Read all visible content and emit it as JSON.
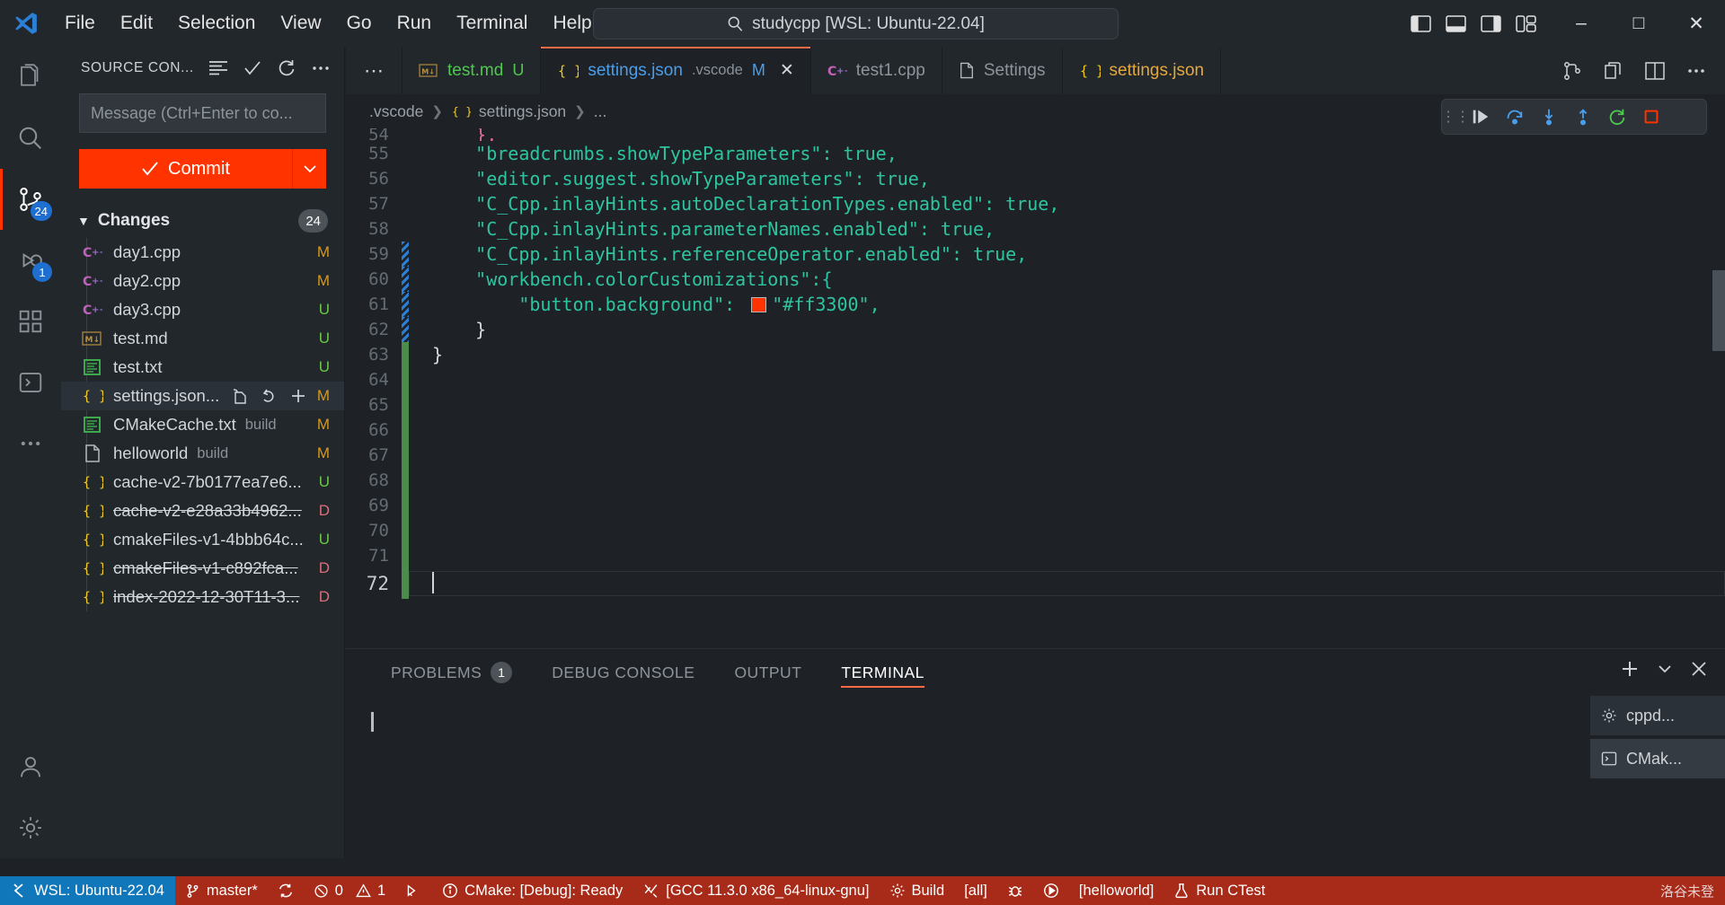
{
  "titlebar": {
    "menus": [
      "File",
      "Edit",
      "Selection",
      "View",
      "Go",
      "Run",
      "Terminal",
      "Help"
    ],
    "back_icon": "arrow-left-icon",
    "forward_icon": "arrow-right-icon",
    "command_center_text": "studycpp [WSL: Ubuntu-22.04]",
    "search_icon": "search-icon",
    "window_controls": [
      "minimize",
      "maximize",
      "close"
    ],
    "layout_icons": [
      "panel-left-icon",
      "panel-bottom-icon",
      "panel-right-icon",
      "layout-grid-icon"
    ]
  },
  "activitybar": {
    "items": [
      {
        "name": "explorer",
        "icon": "files-icon",
        "badge": "",
        "active": false
      },
      {
        "name": "search",
        "icon": "search-icon",
        "badge": "",
        "active": false
      },
      {
        "name": "source-control",
        "icon": "source-control-icon",
        "badge": "24",
        "active": true
      },
      {
        "name": "run-and-debug",
        "icon": "debug-icon",
        "badge": "1",
        "active": false
      },
      {
        "name": "extensions",
        "icon": "extensions-icon",
        "badge": "",
        "active": false
      },
      {
        "name": "testing",
        "icon": "beaker-icon",
        "badge": "",
        "active": false
      },
      {
        "name": "more-views",
        "icon": "ellipsis-icon",
        "badge": "",
        "active": false
      }
    ],
    "bottom_items": [
      {
        "name": "accounts",
        "icon": "account-icon"
      },
      {
        "name": "manage-settings",
        "icon": "gear-icon"
      }
    ]
  },
  "sidebar": {
    "title": "SOURCE CON...",
    "header_actions": [
      "view-as-list-icon",
      "commit-check-icon",
      "refresh-icon",
      "more-actions-icon"
    ],
    "commit_input_placeholder": "Message (Ctrl+Enter to co...",
    "commit_button_label": "Commit",
    "commit_button_color": "#ff3300",
    "commit_dropdown_icon": "chevron-down-icon",
    "changes_label": "Changes",
    "changes_count": "24",
    "files": [
      {
        "name": "day1.cpp",
        "dir": "",
        "icon": "cpp-file-icon",
        "status": "M",
        "deleted": false,
        "selected": false
      },
      {
        "name": "day2.cpp",
        "dir": "",
        "icon": "cpp-file-icon",
        "status": "M",
        "deleted": false,
        "selected": false
      },
      {
        "name": "day3.cpp",
        "dir": "",
        "icon": "cpp-file-icon",
        "status": "U",
        "deleted": false,
        "selected": false
      },
      {
        "name": "test.md",
        "dir": "",
        "icon": "markdown-file-icon",
        "status": "U",
        "deleted": false,
        "selected": false
      },
      {
        "name": "test.txt",
        "dir": "",
        "icon": "text-file-icon",
        "status": "U",
        "deleted": false,
        "selected": false
      },
      {
        "name": "settings.json...",
        "dir": "",
        "icon": "json-file-icon",
        "status": "M",
        "deleted": false,
        "selected": true
      },
      {
        "name": "CMakeCache.txt",
        "dir": "build",
        "icon": "text-file-icon",
        "status": "M",
        "deleted": false,
        "selected": false
      },
      {
        "name": "helloworld",
        "dir": "build",
        "icon": "plain-file-icon",
        "status": "M",
        "deleted": false,
        "selected": false
      },
      {
        "name": "cache-v2-7b0177ea7e6...",
        "dir": "",
        "icon": "json-file-icon",
        "status": "U",
        "deleted": false,
        "selected": false
      },
      {
        "name": "cache-v2-e28a33b4962...",
        "dir": "",
        "icon": "json-file-icon",
        "status": "D",
        "deleted": true,
        "selected": false
      },
      {
        "name": "cmakeFiles-v1-4bbb64c...",
        "dir": "",
        "icon": "json-file-icon",
        "status": "U",
        "deleted": false,
        "selected": false
      },
      {
        "name": "cmakeFiles-v1-c892fca...",
        "dir": "",
        "icon": "json-file-icon",
        "status": "D",
        "deleted": true,
        "selected": false
      },
      {
        "name": "index-2022-12-30T11-3...",
        "dir": "",
        "icon": "json-file-icon",
        "status": "D",
        "deleted": true,
        "selected": false
      }
    ],
    "row_actions": [
      "open-file-icon",
      "discard-changes-icon",
      "stage-changes-icon"
    ]
  },
  "editor": {
    "tab_overflow_icon": "ellipsis-icon",
    "tabs": [
      {
        "label": "test.md",
        "icon": "markdown-file-icon",
        "suffix": "",
        "badge": "U",
        "active": false,
        "closable": false
      },
      {
        "label": "settings.json",
        "icon": "json-file-icon",
        "suffix": ".vscode",
        "badge": "M",
        "active": true,
        "closable": true
      },
      {
        "label": "test1.cpp",
        "icon": "cpp-file-icon",
        "suffix": "",
        "badge": "",
        "active": false,
        "closable": false
      },
      {
        "label": "Settings",
        "icon": "plain-file-icon",
        "suffix": "",
        "badge": "",
        "active": false,
        "closable": false
      },
      {
        "label": "settings.json",
        "icon": "json-file-icon",
        "suffix": "",
        "badge": "",
        "active": false,
        "closable": false
      }
    ],
    "tabbar_actions": [
      "split-and-compare-icon",
      "open-changes-icon",
      "split-editor-icon",
      "more-actions-icon"
    ],
    "breadcrumb": [
      ".vscode",
      "settings.json",
      "..."
    ],
    "breadcrumb_icon": "json-file-icon",
    "debug_toolbar": {
      "grip_icon": "drag-grip-icon",
      "buttons": [
        "continue-icon",
        "step-over-icon",
        "step-into-icon",
        "step-out-icon",
        "restart-icon",
        "stop-icon"
      ],
      "stop_color": "#ff3300"
    },
    "lines": [
      {
        "num": "54",
        "text": "    },",
        "mark": "",
        "current": false,
        "partial": true
      },
      {
        "num": "55",
        "text": "    \"breadcrumbs.showTypeParameters\": true,",
        "mark": "",
        "current": false
      },
      {
        "num": "56",
        "text": "    \"editor.suggest.showTypeParameters\": true,",
        "mark": "",
        "current": false
      },
      {
        "num": "57",
        "text": "    \"C_Cpp.inlayHints.autoDeclarationTypes.enabled\": true,",
        "mark": "",
        "current": false
      },
      {
        "num": "58",
        "text": "    \"C_Cpp.inlayHints.parameterNames.enabled\": true,",
        "mark": "",
        "current": false
      },
      {
        "num": "59",
        "text": "    \"C_Cpp.inlayHints.referenceOperator.enabled\": true,",
        "mark": "mod",
        "current": false
      },
      {
        "num": "60",
        "text": "    \"workbench.colorCustomizations\":{",
        "mark": "mod",
        "current": false
      },
      {
        "num": "61",
        "text": "        \"button.background\": ",
        "mark": "mod",
        "current": false,
        "swatch": "#ff3300",
        "after_swatch": "\"#ff3300\","
      },
      {
        "num": "62",
        "text": "    }",
        "mark": "mod",
        "current": false
      },
      {
        "num": "63",
        "text": "}",
        "mark": "add",
        "current": false
      },
      {
        "num": "64",
        "text": "",
        "mark": "add",
        "current": false
      },
      {
        "num": "65",
        "text": "",
        "mark": "add",
        "current": false
      },
      {
        "num": "66",
        "text": "",
        "mark": "add",
        "current": false
      },
      {
        "num": "67",
        "text": "",
        "mark": "add",
        "current": false
      },
      {
        "num": "68",
        "text": "",
        "mark": "add",
        "current": false
      },
      {
        "num": "69",
        "text": "",
        "mark": "add",
        "current": false
      },
      {
        "num": "70",
        "text": "",
        "mark": "add",
        "current": false
      },
      {
        "num": "71",
        "text": "",
        "mark": "add",
        "current": false
      },
      {
        "num": "72",
        "text": "",
        "mark": "add",
        "current": true
      }
    ]
  },
  "panel": {
    "tabs": [
      {
        "label": "PROBLEMS",
        "badge": "1",
        "active": false
      },
      {
        "label": "DEBUG CONSOLE",
        "badge": "",
        "active": false
      },
      {
        "label": "OUTPUT",
        "badge": "",
        "active": false
      },
      {
        "label": "TERMINAL",
        "badge": "",
        "active": true
      }
    ],
    "actions": [
      "new-terminal-icon",
      "chevron-down-icon",
      "close-panel-icon"
    ],
    "terminal_prompt": "",
    "terminal_tabs": [
      {
        "label": "cppd...",
        "icon": "gear-icon",
        "active": false
      },
      {
        "label": "CMak...",
        "icon": "terminal-icon",
        "active": true
      }
    ]
  },
  "statusbar": {
    "remote_label": "WSL: Ubuntu-22.04",
    "remote_icon": "remote-icon",
    "remote_color": "#1177bb",
    "background_color": "#a82a18",
    "branch": "master*",
    "branch_icon": "source-control-icon",
    "sync_icon": "sync-icon",
    "errors": "0",
    "warnings": "1",
    "error_icon": "error-icon",
    "warning_icon": "warning-icon",
    "ports_icon": "ports-icon",
    "cmake_status": "CMake: [Debug]: Ready",
    "cmake_icon": "info-icon",
    "kit": "[GCC 11.3.0 x86_64-linux-gnu]",
    "kit_icon": "tools-icon",
    "build": "Build",
    "build_icon": "gear-icon",
    "target": "[all]",
    "debug_target_icon": "bug-icon",
    "run_icon": "play-icon",
    "launch_target": "[helloworld]",
    "ctest": "Run CTest",
    "ctest_icon": "beaker-icon",
    "ime_text": "洛谷未登"
  }
}
